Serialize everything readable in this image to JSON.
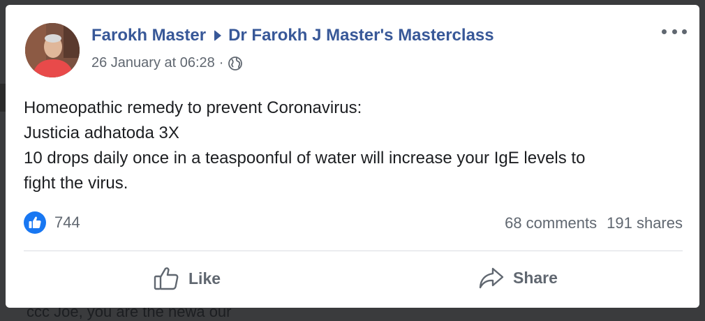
{
  "background": {
    "partial_text": "ccc Joe, you are the newa our"
  },
  "post": {
    "author": "Farokh Master",
    "group": "Dr Farokh J Master's Masterclass",
    "timestamp": "26 January at 06:28",
    "separator": "·",
    "privacy_icon": "globe-icon",
    "more_icon": "more-options-icon",
    "body_lines": [
      "Homeopathic remedy to prevent Coronavirus:",
      "Justicia adhatoda 3X",
      "10 drops daily once in a teaspoonful of water will increase your IgE levels to",
      "fight the virus."
    ],
    "reaction_count": "744",
    "comments": "68 comments",
    "shares": "191 shares"
  },
  "actions": {
    "like": "Like",
    "share": "Share"
  },
  "colors": {
    "link_blue": "#385898",
    "like_blue": "#1877f2",
    "secondary_text": "#606770",
    "primary_text": "#1c1e21"
  }
}
